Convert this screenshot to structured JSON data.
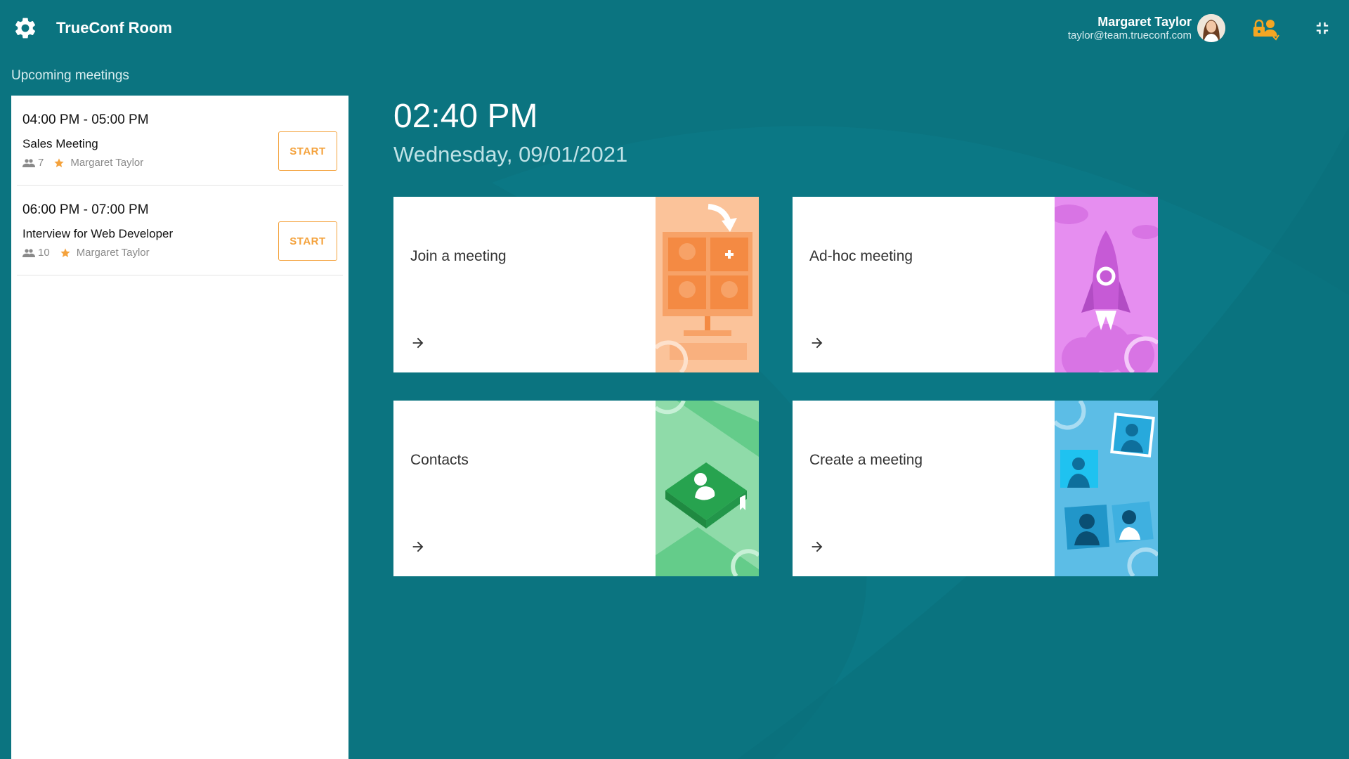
{
  "header": {
    "app_title": "TrueConf Room",
    "user_name": "Margaret Taylor",
    "user_email": "taylor@team.trueconf.com",
    "icons": [
      "gear-icon",
      "avatar",
      "lock-user-icon",
      "exit-fullscreen-icon"
    ]
  },
  "upcoming": {
    "label": "Upcoming meetings",
    "meetings": [
      {
        "time": "04:00 PM - 05:00 PM",
        "title": "Sales Meeting",
        "participants": "7",
        "owner": "Margaret Taylor",
        "start_label": "START"
      },
      {
        "time": "06:00 PM - 07:00 PM",
        "title": "Interview for Web Developer",
        "participants": "10",
        "owner": "Margaret Taylor",
        "start_label": "START"
      }
    ]
  },
  "clock": {
    "time": "02:40 PM",
    "date": "Wednesday, 09/01/2021"
  },
  "tiles": [
    {
      "label": "Join a meeting",
      "accent": "#f9a56b"
    },
    {
      "label": "Ad-hoc meeting",
      "accent": "#e68ef0"
    },
    {
      "label": "Contacts",
      "accent": "#3fbf6f"
    },
    {
      "label": "Create a meeting",
      "accent": "#4cb6e2"
    }
  ],
  "colors": {
    "background": "#0b7480",
    "start_button": "#f4a23c",
    "lock_icon": "#f5a623"
  }
}
